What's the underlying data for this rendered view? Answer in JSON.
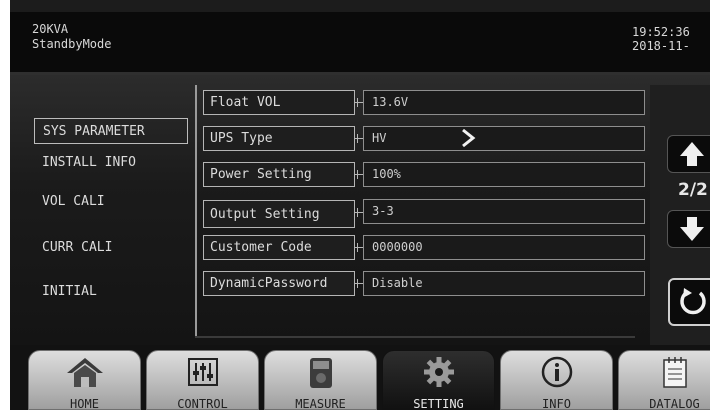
{
  "header": {
    "model": "20KVA",
    "mode": "StandbyMode",
    "time": "19:52:36",
    "date": "2018-11-"
  },
  "sidebar": {
    "items": [
      {
        "label": "SYS PARAMETER",
        "selected": true
      },
      {
        "label": "INSTALL INFO",
        "selected": false
      },
      {
        "label": "VOL CALI",
        "selected": false
      },
      {
        "label": "CURR CALI",
        "selected": false
      },
      {
        "label": "INITIAL",
        "selected": false
      }
    ]
  },
  "settings": {
    "rows": [
      {
        "label": "Float VOL",
        "value": "13.6V"
      },
      {
        "label": "UPS Type",
        "value": "HV"
      },
      {
        "label": "Power Setting",
        "value": "100%"
      },
      {
        "label": "Output Setting",
        "value": "3-3"
      },
      {
        "label": "Customer Code",
        "value": "0000000"
      },
      {
        "label": "DynamicPassword",
        "value": "Disable"
      }
    ]
  },
  "pager": {
    "indicator": "2/2"
  },
  "tabs": [
    {
      "label": "HOME",
      "icon": "home-icon"
    },
    {
      "label": "CONTROL",
      "icon": "sliders-icon"
    },
    {
      "label": "MEASURE",
      "icon": "meter-icon"
    },
    {
      "label": "SETTING",
      "icon": "gear-icon",
      "active": true
    },
    {
      "label": "INFO",
      "icon": "info-icon"
    },
    {
      "label": "DATALOG",
      "icon": "calendar-icon"
    }
  ]
}
